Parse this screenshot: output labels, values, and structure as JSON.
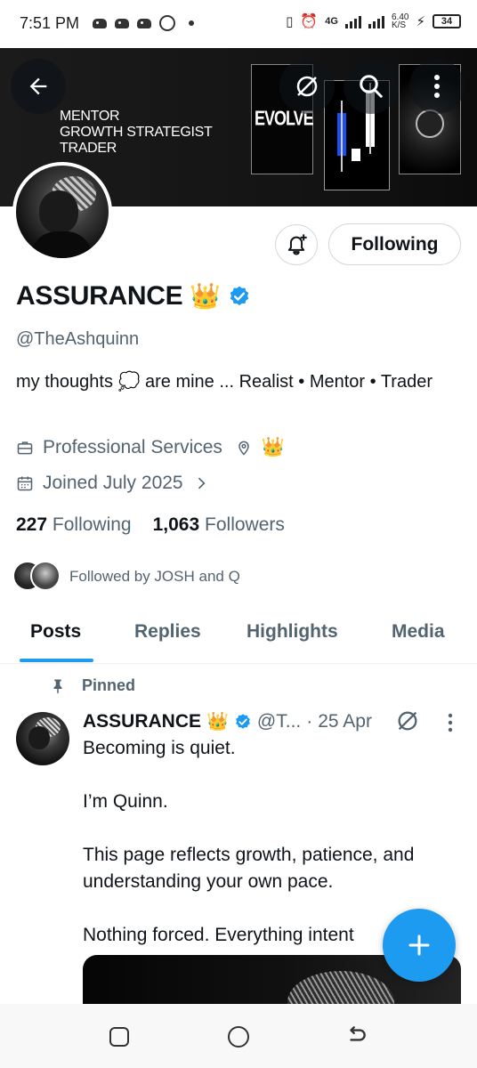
{
  "status_bar": {
    "time": "7:51 PM",
    "network": "4G",
    "speed": "6.40",
    "speed_unit": "K/S",
    "battery": "34"
  },
  "banner": {
    "line1": "MENTOR",
    "line2": "GROWTH STRATEGIST",
    "line3": "TRADER",
    "evolve": "EVOLVE"
  },
  "actions": {
    "following_label": "Following"
  },
  "profile": {
    "display_name": "ASSURANCE",
    "crown": "👑",
    "handle": "@TheAshquinn",
    "bio_part1": "my thoughts",
    "bio_emoji": "💭",
    "bio_part2": "are mine ... Realist • Mentor • Trader",
    "category": "Professional Services",
    "location": "👑",
    "joined": "Joined July 2025",
    "following_count": "227",
    "following_label": "Following",
    "followers_count": "1,063",
    "followers_label": "Followers",
    "followed_by": "Followed by JOSH and Q"
  },
  "tabs": [
    "Posts",
    "Replies",
    "Highlights",
    "Media"
  ],
  "post": {
    "pinned_label": "Pinned",
    "author": "ASSURANCE",
    "crown": "👑",
    "handle": "@T...",
    "separator": "·",
    "date": "25 Apr",
    "lines": [
      "Becoming is quiet.",
      "I’m Quinn.",
      "This page reflects growth, patience, and understanding your own pace.",
      "Nothing forced. Everything intent"
    ]
  },
  "colors": {
    "accent": "#1d9bf0",
    "text_primary": "#0f1419",
    "text_secondary": "#536471",
    "border": "#cfd9de"
  },
  "icons": [
    "back-arrow-icon",
    "grok-icon",
    "search-icon",
    "more-icon",
    "bell-plus-icon",
    "verified-icon",
    "briefcase-icon",
    "location-pin-icon",
    "calendar-icon",
    "chevron-right-icon",
    "pin-icon",
    "compose-plus-icon"
  ]
}
